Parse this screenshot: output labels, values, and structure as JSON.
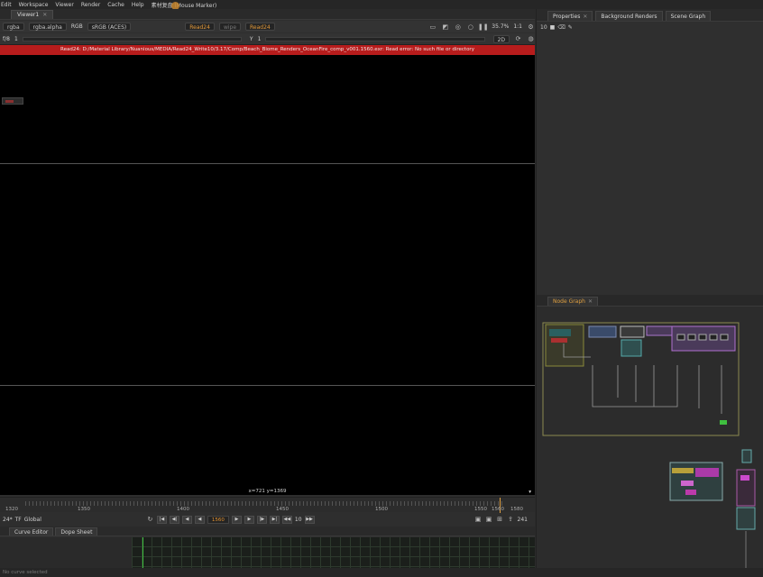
{
  "menu": [
    "Edit",
    "Workspace",
    "Viewer",
    "Render",
    "Cache",
    "Help",
    "素材复盘 (Mouse Marker)"
  ],
  "viewer": {
    "tab_label": "Viewer1",
    "channels": "rgba",
    "layer": "rgba.alpha",
    "colorspace_label": "RGB",
    "display": "sRGB (ACES)",
    "input_a": "Read24",
    "wipe": "wipe",
    "input_b": "Read24",
    "zoom": "35.7%",
    "proxy": "1:1",
    "fstop_label": "f/8",
    "gain": "1",
    "gamma_label": "Y",
    "gamma": "1",
    "view_mode": "2D",
    "error_text": "Read24: D:/Material Library/Nuanious/MEDIA/Read24_Write10/3.17/Comp/Beach_Biome_Renders_OceanFire_comp_v001.1560.exr: Read error: No such file or directory",
    "coords": "x=721 y=1369"
  },
  "timeline": {
    "ticks": [
      "1320",
      "1350",
      "1400",
      "1450",
      "1500",
      "1550",
      "1560",
      "1580"
    ],
    "current_frame": "1560",
    "fps": "24*",
    "tf": "TF",
    "scope": "Global",
    "step": "10",
    "range_end": "241"
  },
  "bottom_tabs": [
    "Curve Editor",
    "Dope Sheet"
  ],
  "status_text": "No curve selected",
  "right_tabs": [
    "Properties",
    "Background Renders",
    "Scene Graph"
  ],
  "properties_tools": [
    "10",
    "■",
    "⌫",
    "✎"
  ],
  "node_graph_tab": "Node Graph",
  "colors": {
    "error_bar": "#b71c1c",
    "accent": "#e0a040",
    "curve_green": "#3fbf3f"
  }
}
